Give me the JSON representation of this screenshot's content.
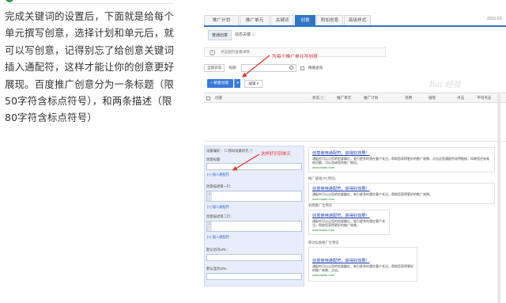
{
  "article": {
    "paragraph": "完成关键词的设置后，下面就是给每个单元撰写创意，选择计划和单元后，就可以写创意，记得别忘了给创意关键词插入通配符，这样才能让你的创意更好展现。百度推广创意分为一条标题（限50字符含标点符号），和两条描述（限80字符含标点符号）"
  },
  "screenshot": {
    "nav_tabs": [
      "推广计划",
      "推广单元",
      "关键词",
      "创意",
      "附加创意",
      "高级样式"
    ],
    "active_tab": "创意",
    "date": "2015-03-",
    "sub_tabs": [
      "普通创意",
      "动态关键 ⓘ"
    ],
    "notice_text": "点击图示查看详情",
    "annotation_top": "为每个推广单元写创意",
    "filter_status": "全部状态",
    "search_label": "标题:",
    "checkbox_label": "精确查询",
    "new_button": "+ 新建创意",
    "edit_select": "编辑",
    "table_headers": [
      "创意",
      "状态 ⓘ",
      "推广单元",
      "推广计划",
      "消费",
      "展现",
      "点击",
      "平均点击"
    ],
    "watermark": "Bai 经验",
    "editor": {
      "device_label": "设备偏好： ☐ 移动设备优先 ⓘ",
      "title_label": "创意标题:",
      "insert_wildcard": "{+} 插入通配符",
      "desc1_label": "创意描述第一行:",
      "desc2_label": "创意描述第二行:",
      "url_label": "默认访问URL:",
      "display_url_label": "默认显示URL:",
      "annotation": "这样好识别单元"
    },
    "preview": {
      "cards": [
        {
          "title": "创意使用通配符，获得好效果！",
          "desc": "通配符可以让您的创意飘红，吸引更多的潜在客户关注。帮助您获得更好的推广效果。点击这里通配符说明链接，如果您还有其他问题，可以咨询您的推广顾问。",
          "url": "www.baidu.com"
        },
        {
          "label": "推广链接(PC预览)",
          "title": "创意使用通配符，获得好效果！",
          "desc": "通配符可以让您的创意飘红，吸引更多的潜在客户关注。帮助您获得更好的推广效果。",
          "url": "www.baidu.com"
        },
        {
          "label": "右侧推广位预览",
          "title": "创意使用通配符，获得好效果！",
          "desc": "通配符可以让您的创意飘红，吸引更多的潜在客户关注。帮助您获得更好的推广效果。",
          "url": "www.baidu.com"
        },
        {
          "label": "移动设备推广位预览",
          "title": "创意使用通配符，获得好效果！",
          "desc": "通配符可以让您的创意飘红，吸引更多的潜在客户关注。帮助您获得更好的推广效果，点击。",
          "url": "www.baidu.com"
        }
      ]
    }
  }
}
